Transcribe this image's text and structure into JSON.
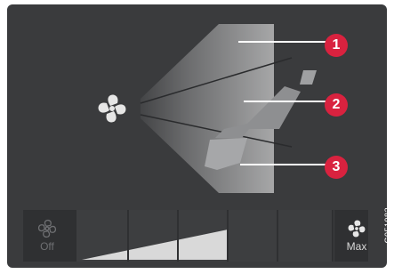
{
  "callouts": [
    "1",
    "2",
    "3"
  ],
  "controls": {
    "off_label": "Off",
    "max_label": "Max",
    "fan_speed_icon_off": "fan-icon",
    "fan_speed_icon_max": "fan-icon"
  },
  "figure_code": "G051982",
  "colors": {
    "panel": "#3a3b3d",
    "callout": "#d9223f"
  }
}
